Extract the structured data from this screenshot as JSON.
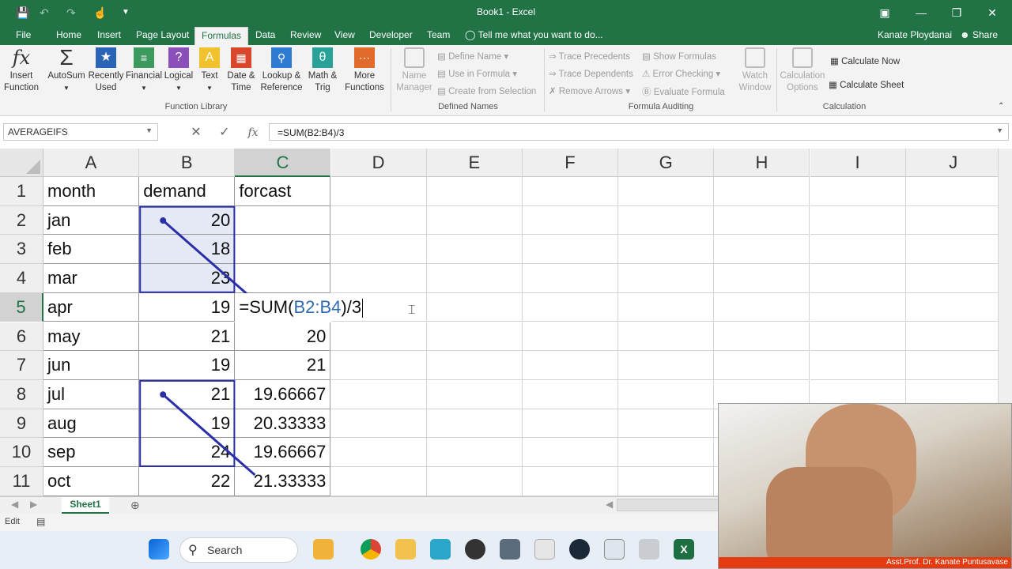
{
  "window": {
    "title": "Book1 - Excel"
  },
  "menu": {
    "tabs": [
      "File",
      "Home",
      "Insert",
      "Page Layout",
      "Formulas",
      "Data",
      "Review",
      "View",
      "Developer",
      "Team"
    ],
    "active": "Formulas",
    "tell_me": "Tell me what you want to do...",
    "user": "Kanate Ploydanai",
    "share": "Share"
  },
  "ribbon": {
    "insert_function": [
      "Insert",
      "Function"
    ],
    "autosum": "AutoSum",
    "recently_used": [
      "Recently",
      "Used"
    ],
    "financial": "Financial",
    "logical": "Logical",
    "text": "Text",
    "date_time": [
      "Date &",
      "Time"
    ],
    "lookup_reference": [
      "Lookup &",
      "Reference"
    ],
    "math_trig": [
      "Math &",
      "Trig"
    ],
    "more_functions": [
      "More",
      "Functions"
    ],
    "function_library_label": "Function Library",
    "name_manager": [
      "Name",
      "Manager"
    ],
    "define_name": "Define Name",
    "use_in_formula": "Use in Formula",
    "create_from_selection": "Create from Selection",
    "defined_names_label": "Defined Names",
    "trace_precedents": "Trace Precedents",
    "trace_dependents": "Trace Dependents",
    "remove_arrows": "Remove Arrows",
    "show_formulas": "Show Formulas",
    "error_checking": "Error Checking",
    "evaluate_formula": "Evaluate Formula",
    "watch_window": [
      "Watch",
      "Window"
    ],
    "formula_auditing_label": "Formula Auditing",
    "calculation_options": [
      "Calculation",
      "Options"
    ],
    "calculate_now": "Calculate Now",
    "calculate_sheet": "Calculate Sheet",
    "calculation_label": "Calculation"
  },
  "formula_bar": {
    "name_box": "AVERAGEIFS",
    "formula": "=SUM(B2:B4)/3"
  },
  "columns": [
    "A",
    "B",
    "C",
    "D",
    "E",
    "F",
    "G",
    "H",
    "I",
    "J"
  ],
  "rows": [
    "1",
    "2",
    "3",
    "4",
    "5",
    "6",
    "7",
    "8",
    "9",
    "10",
    "11"
  ],
  "cells": {
    "A1": "month",
    "B1": "demand",
    "C1": "forcast",
    "A2": "jan",
    "B2": "20",
    "A3": "feb",
    "B3": "18",
    "A4": "mar",
    "B4": "23",
    "A5": "apr",
    "B5": "19",
    "A6": "may",
    "B6": "21",
    "C6": "20",
    "A7": "jun",
    "B7": "19",
    "C7": "21",
    "A8": "jul",
    "B8": "21",
    "C8": "19.66667",
    "A9": "aug",
    "B9": "19",
    "C9": "20.33333",
    "A10": "sep",
    "B10": "24",
    "C10": "19.66667",
    "A11": "oct",
    "B11": "22",
    "C11": "21.33333"
  },
  "editing_cell": {
    "prefix": "=SUM(",
    "ref": "B2:B4",
    "suffix": ")/3"
  },
  "sheet": {
    "tab": "Sheet1"
  },
  "status": {
    "mode": "Edit"
  },
  "taskbar": {
    "search": "Search"
  },
  "webcam": {
    "caption": "Asst.Prof. Dr. Kanate Puntusavase"
  }
}
